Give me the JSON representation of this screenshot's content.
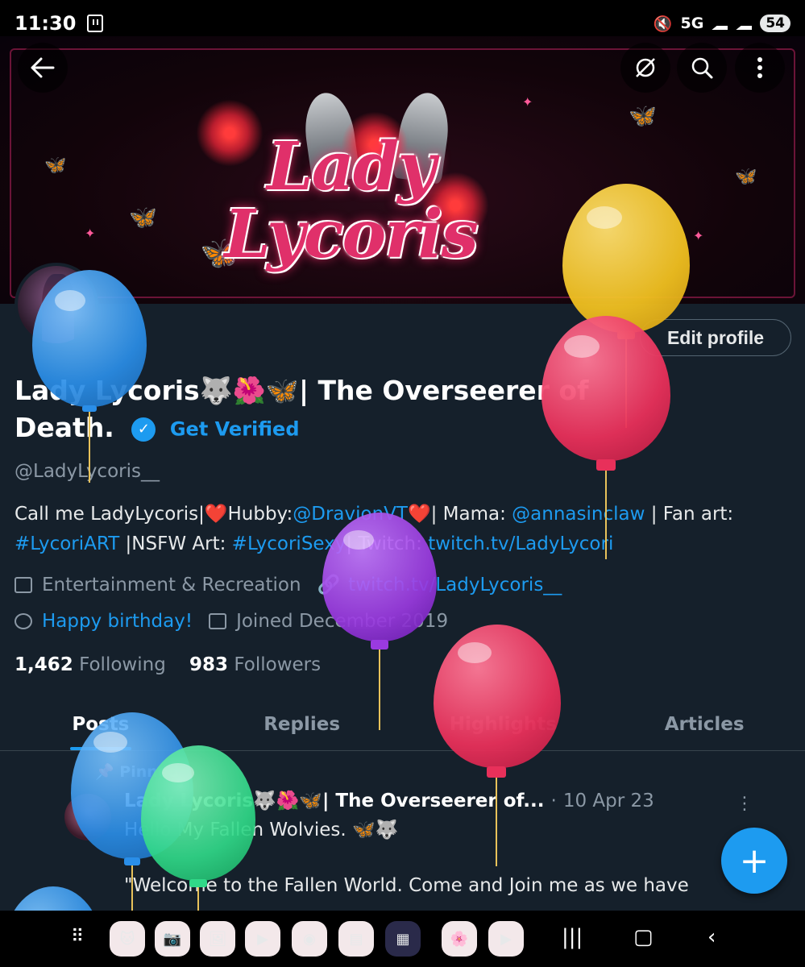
{
  "status_bar": {
    "time": "11:30",
    "network": "5G",
    "battery": "54",
    "icons": [
      "twitch-notification-icon",
      "mute-icon",
      "signal-icon",
      "signal-icon"
    ]
  },
  "banner": {
    "title_line1": "Lady",
    "title_line2": "Lycoris",
    "back_icon": "back-arrow-icon",
    "actions": [
      "hide-icon",
      "search-icon",
      "more-vertical-icon"
    ]
  },
  "profile": {
    "edit_button": "Edit profile",
    "display_name": "Lady Lycoris🐺🌺🦋| The Overseerer of Death.",
    "verified_label": "Get Verified",
    "handle": "@LadyLycoris__",
    "bio_parts": {
      "p1": "Call me LadyLycoris|❤️Hubby:",
      "link1": "@DravionVT",
      "p2": "❤️| Mama: ",
      "link2": "@annasinclaw",
      "p3": " | Fan art: ",
      "link3": "#LycoriART",
      "p4": " |NSFW Art: ",
      "link4": "#LycoriSexy",
      "p5": "| Twitch: ",
      "link5": "twitch.tv/LadyLycori"
    },
    "category": "Entertainment & Recreation",
    "website": "twitch.tv/LadyLycoris__",
    "birthday": "Happy birthday!",
    "joined": "Joined December 2019",
    "following_count": "1,462",
    "following_label": "Following",
    "followers_count": "983",
    "followers_label": "Followers"
  },
  "tabs": [
    {
      "label": "Posts",
      "active": true
    },
    {
      "label": "Replies",
      "active": false
    },
    {
      "label": "Highlights",
      "active": false
    },
    {
      "label": "Articles",
      "active": false
    }
  ],
  "post": {
    "pinned_label": "Pinned",
    "author": "Lady Lycoris🐺🌺🦋| The Overseerer of...",
    "dots": "·",
    "date": "10 Apr 23",
    "line1": "Hello My Fallen Wolvies. 🦋🐺",
    "line2": "\"Welcome to the Fallen World. Come and Join me as we have"
  },
  "fab": {
    "label": "+"
  },
  "nav_bar": {
    "apps": [
      "app-drawer-icon",
      "cat-app-icon",
      "camera-icon",
      "gallery-icon",
      "play-store-icon",
      "youtube-music-icon",
      "wallet-icon",
      "multi-window-icon",
      "anime-app-icon",
      "youtube-icon"
    ],
    "keys": [
      "recents-icon",
      "home-icon",
      "back-icon"
    ]
  },
  "colors": {
    "background": "#15202b",
    "accent": "#1d9bf0",
    "muted_text": "#8b98a5",
    "balloon_blue": "#3aa0f0",
    "balloon_yellow": "#f0c020",
    "balloon_red": "#e8305a",
    "balloon_purple": "#9a3ae0",
    "balloon_green": "#30d888"
  }
}
